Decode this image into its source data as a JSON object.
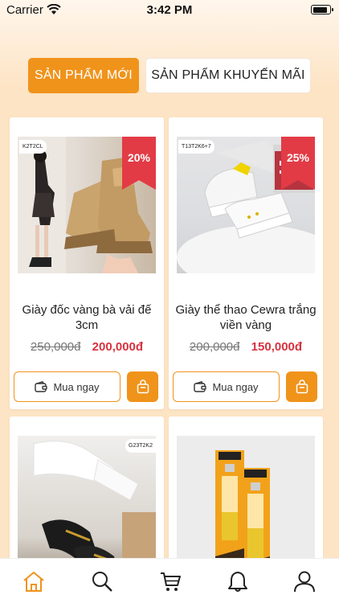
{
  "status_bar": {
    "carrier": "Carrier",
    "time": "3:42 PM",
    "battery_level": 0.9
  },
  "tabs": [
    {
      "label": "SẢN PHẨM MỚI",
      "active": true
    },
    {
      "label": "SẢN PHẨM KHUYẾN MÃI",
      "active": false
    }
  ],
  "colors": {
    "accent": "#f0931b",
    "badge": "#e23b46",
    "price": "#d8323f",
    "background": "#fde4c4"
  },
  "products": [
    {
      "sku": "K2T2CL",
      "discount": "20%",
      "name": "Giày đốc vàng bà vải đế 3cm",
      "old_price": "250,000đ",
      "price": "200,000đ",
      "buy_label": "Mua ngay"
    },
    {
      "sku": "T13T2K6+7",
      "discount": "25%",
      "name": "Giày thể thao Cewra trắng viền vàng",
      "old_price": "200,000đ",
      "price": "150,000đ",
      "buy_label": "Mua ngay"
    },
    {
      "sku": "G23T2K2"
    },
    {
      "sku": ""
    }
  ],
  "nav": [
    {
      "icon": "home-icon",
      "active": true
    },
    {
      "icon": "search-icon",
      "active": false
    },
    {
      "icon": "cart-icon",
      "active": false
    },
    {
      "icon": "bell-icon",
      "active": false
    },
    {
      "icon": "user-icon",
      "active": false
    }
  ]
}
